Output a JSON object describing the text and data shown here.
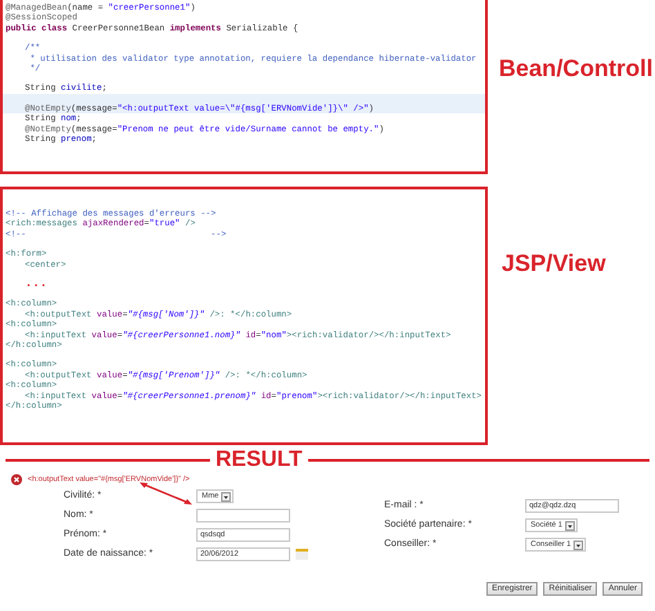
{
  "panels": [
    {
      "label": "Bean/Controll",
      "lines": [
        {
          "segments": [
            {
              "text": "@ManagedBean",
              "kind": "annotation"
            },
            {
              "text": "(name = ",
              "kind": "plain"
            },
            {
              "text": "\"creerPersonne1\"",
              "kind": "string"
            },
            {
              "text": ")",
              "kind": "plain"
            }
          ]
        },
        {
          "segments": [
            {
              "text": "@SessionScoped",
              "kind": "annotation"
            }
          ]
        },
        {
          "segments": [
            {
              "text": "public class ",
              "kind": "keyword"
            },
            {
              "text": "CreerPersonne1Bean ",
              "kind": "plain"
            },
            {
              "text": "implements ",
              "kind": "keyword"
            },
            {
              "text": "Serializable {",
              "kind": "plain"
            }
          ]
        },
        {
          "blank_before": true,
          "indent": true,
          "segments": [
            {
              "text": "/**",
              "kind": "comment"
            }
          ]
        },
        {
          "indent": true,
          "segments": [
            {
              "text": " * utilisation des validator type annotation, requiere la dependance hibernate-validator",
              "kind": "comment"
            }
          ]
        },
        {
          "indent": true,
          "segments": [
            {
              "text": " */",
              "kind": "comment"
            }
          ]
        },
        {
          "blank_before": true,
          "indent": true,
          "segments": [
            {
              "text": "String ",
              "kind": "plain"
            },
            {
              "text": "civilite",
              "kind": "field"
            },
            {
              "text": ";",
              "kind": "plain"
            }
          ]
        },
        {
          "blank_before": true,
          "indent": true,
          "highlighted": true,
          "segments": [
            {
              "text": "@NotEmpty",
              "kind": "annotation"
            },
            {
              "text": "(message=",
              "kind": "plain"
            },
            {
              "text": "\"<h:outputText value=\\\"#{msg['ERVNomVide']}\\\" />\"",
              "kind": "string"
            },
            {
              "text": ")",
              "kind": "plain"
            }
          ]
        },
        {
          "indent": true,
          "segments": [
            {
              "text": "String ",
              "kind": "plain"
            },
            {
              "text": "nom",
              "kind": "field"
            },
            {
              "text": ";",
              "kind": "plain"
            }
          ]
        },
        {
          "indent": true,
          "segments": [
            {
              "text": "@NotEmpty",
              "kind": "annotation"
            },
            {
              "text": "(message=",
              "kind": "plain"
            },
            {
              "text": "\"Prenom ne peut être vide/Surname cannot be empty.\"",
              "kind": "string"
            },
            {
              "text": ")",
              "kind": "plain"
            }
          ]
        },
        {
          "indent": true,
          "segments": [
            {
              "text": "String ",
              "kind": "plain"
            },
            {
              "text": "prenom",
              "kind": "field"
            },
            {
              "text": ";",
              "kind": "plain"
            }
          ]
        }
      ]
    },
    {
      "label": "JSP/View",
      "lines": [
        {
          "blank_before": true,
          "segments": [
            {
              "text": "<!-- Affichage des messages d'erreurs -->",
              "kind": "comment"
            }
          ]
        },
        {
          "segments": [
            {
              "text": "<rich:messages ",
              "kind": "tag"
            },
            {
              "text": "ajaxRendered",
              "kind": "attribute"
            },
            {
              "text": "=",
              "kind": "plain"
            },
            {
              "text": "\"true\"",
              "kind": "string"
            },
            {
              "text": " />",
              "kind": "tag"
            }
          ]
        },
        {
          "segments": [
            {
              "text": "<!--                                    -->",
              "kind": "comment"
            }
          ]
        },
        {
          "blank_before": true,
          "segments": [
            {
              "text": "<h:form>",
              "kind": "tag"
            }
          ]
        },
        {
          "indent": true,
          "segments": [
            {
              "text": "<center>",
              "kind": "tag"
            }
          ]
        },
        {
          "blank_before": true,
          "indent": true,
          "segments": [
            {
              "text": "...",
              "kind": "ellipsis"
            }
          ]
        },
        {
          "blank_before": true,
          "segments": [
            {
              "text": "<h:column>",
              "kind": "tag"
            }
          ]
        },
        {
          "indent": true,
          "segments": [
            {
              "text": "<h:outputText ",
              "kind": "tag"
            },
            {
              "text": "value",
              "kind": "attribute"
            },
            {
              "text": "=",
              "kind": "plain"
            },
            {
              "text": "\"#{msg['Nom']}\"",
              "kind": "expression"
            },
            {
              "text": " />: *</h:column>",
              "kind": "tag"
            }
          ]
        },
        {
          "segments": [
            {
              "text": "<h:column>",
              "kind": "tag"
            }
          ]
        },
        {
          "indent": true,
          "segments": [
            {
              "text": "<h:inputText ",
              "kind": "tag"
            },
            {
              "text": "value",
              "kind": "attribute"
            },
            {
              "text": "=",
              "kind": "plain"
            },
            {
              "text": "\"#{creerPersonne1.nom}\"",
              "kind": "expression"
            },
            {
              "text": " id",
              "kind": "attribute"
            },
            {
              "text": "=",
              "kind": "plain"
            },
            {
              "text": "\"nom\"",
              "kind": "string"
            },
            {
              "text": "><rich:validator/></h:inputText>",
              "kind": "tag"
            }
          ]
        },
        {
          "segments": [
            {
              "text": "</h:column>",
              "kind": "tag"
            }
          ]
        },
        {
          "blank_before": true,
          "segments": [
            {
              "text": "<h:column>",
              "kind": "tag"
            }
          ]
        },
        {
          "indent": true,
          "segments": [
            {
              "text": "<h:outputText ",
              "kind": "tag"
            },
            {
              "text": "value",
              "kind": "attribute"
            },
            {
              "text": "=",
              "kind": "plain"
            },
            {
              "text": "\"#{msg['Prenom']}\"",
              "kind": "expression"
            },
            {
              "text": " />: *</h:column>",
              "kind": "tag"
            }
          ]
        },
        {
          "segments": [
            {
              "text": "<h:column>",
              "kind": "tag"
            }
          ]
        },
        {
          "indent": true,
          "segments": [
            {
              "text": "<h:inputText ",
              "kind": "tag"
            },
            {
              "text": "value",
              "kind": "attribute"
            },
            {
              "text": "=",
              "kind": "plain"
            },
            {
              "text": "\"#{creerPersonne1.prenom}\"",
              "kind": "expression"
            },
            {
              "text": " id",
              "kind": "attribute"
            },
            {
              "text": "=",
              "kind": "plain"
            },
            {
              "text": "\"prenom\"",
              "kind": "string"
            },
            {
              "text": "><rich:validator/></h:inputText>",
              "kind": "tag"
            }
          ]
        },
        {
          "segments": [
            {
              "text": "</h:column>",
              "kind": "tag"
            }
          ]
        }
      ]
    }
  ],
  "result": {
    "heading": "RESULT",
    "error": "<h:outputText value=\"#{msg['ERVNomVide']}\" />",
    "left_fields": [
      {
        "label": "Civilité: *",
        "kind": "select",
        "value": "Mme"
      },
      {
        "label": "Nom: *",
        "kind": "text"
      },
      {
        "label": "Prénom: *",
        "kind": "text",
        "value": "qsdsqd"
      },
      {
        "label": "Date de naissance: *",
        "kind": "date",
        "value": "20/06/2012"
      }
    ],
    "right_fields": [
      {
        "label": "E-mail : *",
        "kind": "text",
        "value": "qdz@qdz.dzq"
      },
      {
        "label": "Société partenaire: *",
        "kind": "select",
        "value": "Société 1"
      },
      {
        "label": "Conseiller: *",
        "kind": "select",
        "value": "Conseiller 1"
      }
    ],
    "buttons": [
      "Enregistrer",
      "Réinitialiser",
      "Annuler"
    ]
  }
}
